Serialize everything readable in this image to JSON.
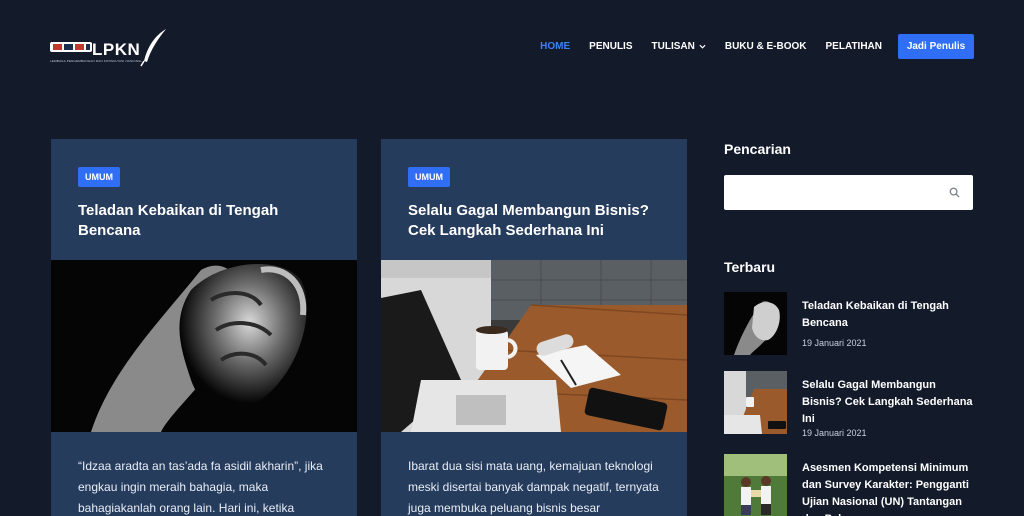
{
  "brand": {
    "name": "LPKN",
    "tagline": "LEMBAGA PENGEMBANGAN DAN KONSULTASI NASIONAL"
  },
  "nav": {
    "items": [
      {
        "label": "HOME",
        "active": true
      },
      {
        "label": "PENULIS",
        "active": false
      },
      {
        "label": "TULISAN",
        "active": false,
        "has_dropdown": true
      },
      {
        "label": "BUKU & E-BOOK",
        "active": false
      },
      {
        "label": "PELATIHAN",
        "active": false
      }
    ],
    "cta_label": "Jadi Penulis"
  },
  "posts": [
    {
      "category": "UMUM",
      "title": "Teladan Kebaikan di Tengah Bencana",
      "image": "holding-hands-photo",
      "excerpt": "“Idzaa aradta an tas’ada fa asidil akharin”, jika engkau ingin meraih bahagia, maka bahagiakanlah orang lain. Hari ini, ketika"
    },
    {
      "category": "UMUM",
      "title": "Selalu Gagal Membangun Bisnis? Cek Langkah Sederhana Ini",
      "image": "laptop-desk-photo",
      "excerpt": "Ibarat dua sisi mata uang, kemajuan teknologi meski disertai banyak dampak negatif, ternyata juga membuka peluang bisnis besar"
    }
  ],
  "sidebar": {
    "search_title": "Pencarian",
    "search_placeholder": "",
    "recent_title": "Terbaru",
    "recent": [
      {
        "title": "Teladan Kebaikan di Tengah Bencana",
        "date": "19 Januari 2021"
      },
      {
        "title": "Selalu Gagal Membangun Bisnis? Cek Langkah Sederhana Ini",
        "date": "19 Januari 2021"
      },
      {
        "title": "Asesmen Kompetensi Minimum dan Survey Karakter: Pengganti Ujian Nasional (UN) Tantangan dan Peluang",
        "date": ""
      }
    ]
  },
  "colors": {
    "background": "#131a2a",
    "card": "#263c5c",
    "accent": "#2f6ef5",
    "nav_active": "#3b82f6"
  }
}
